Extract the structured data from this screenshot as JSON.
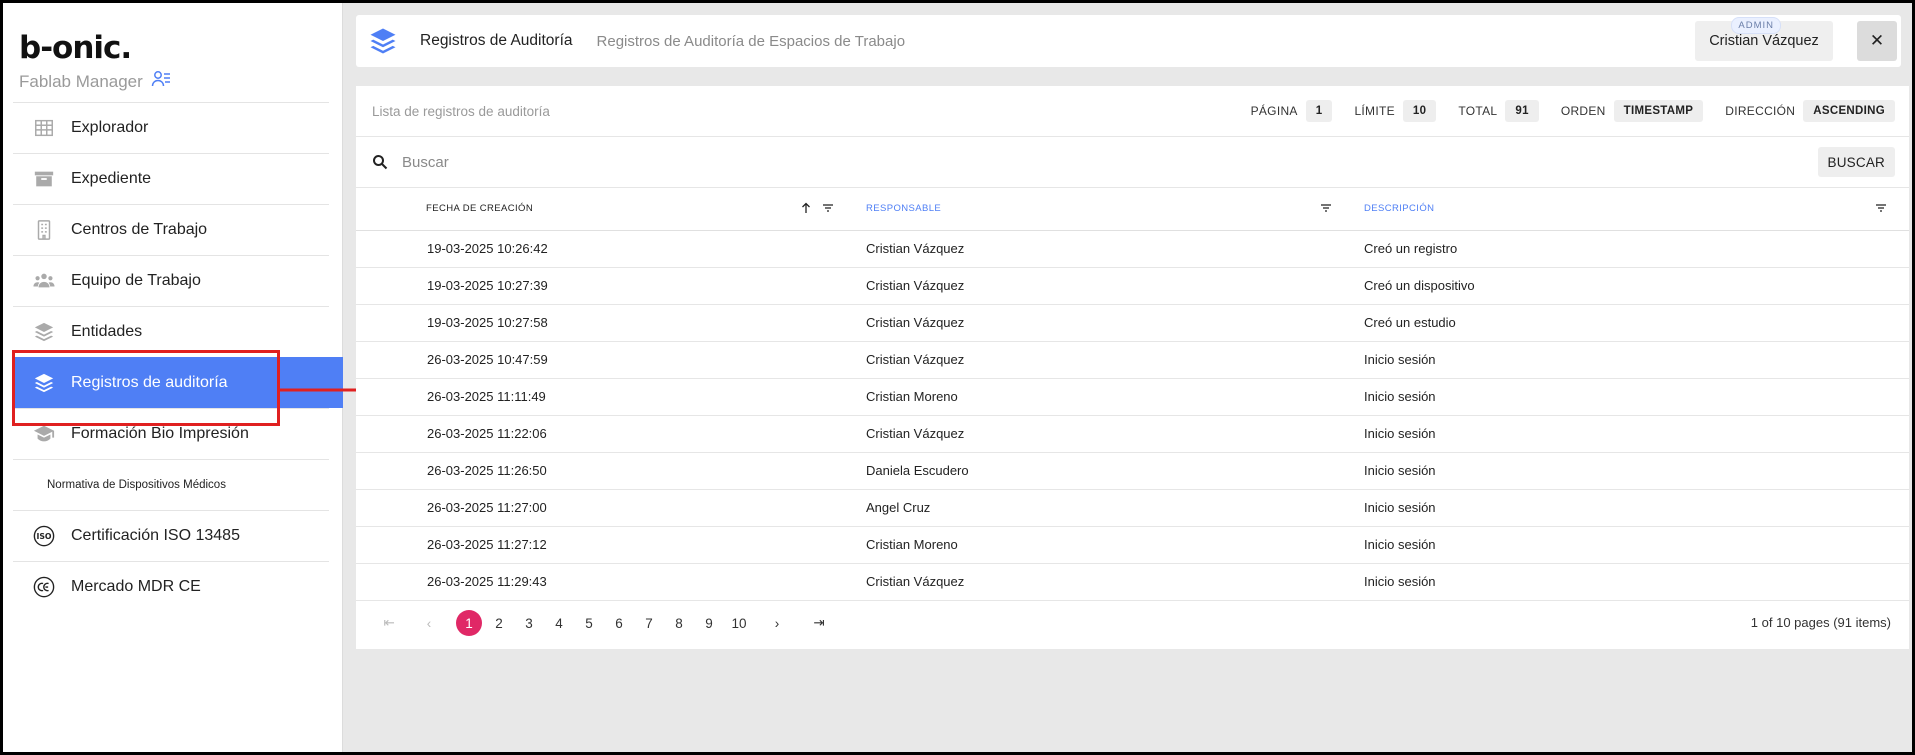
{
  "brand": {
    "logo": "b-onic.",
    "subtitle": "Fablab Manager"
  },
  "sidebar": {
    "items": [
      {
        "label": "Explorador",
        "icon": "grid-icon",
        "active": false
      },
      {
        "label": "Expediente",
        "icon": "archive-box-icon",
        "active": false
      },
      {
        "label": "Centros de Trabajo",
        "icon": "building-icon",
        "active": false
      },
      {
        "label": "Equipo de Trabajo",
        "icon": "team-icon",
        "active": false
      },
      {
        "label": "Entidades",
        "icon": "layers-icon",
        "active": false
      },
      {
        "label": "Registros de auditoría",
        "icon": "layers-icon",
        "active": true
      },
      {
        "label": "Formación Bio Impresión",
        "icon": "graduation-cap-icon",
        "active": false
      },
      {
        "label": "Normativa de Dispositivos Médicos",
        "icon": "",
        "active": false
      },
      {
        "label": "Certificación ISO 13485",
        "icon": "iso-icon",
        "active": false
      },
      {
        "label": "Mercado MDR CE",
        "icon": "ce-mark-icon",
        "active": false
      }
    ]
  },
  "header": {
    "title": "Registros de Auditoría",
    "subtitle": "Registros de Auditoría de Espacios de Trabajo",
    "user": "Cristian Vázquez",
    "role_badge": "ADMIN",
    "close_label": "✕"
  },
  "list": {
    "title": "Lista de registros de auditoría",
    "meta": [
      {
        "label": "PÁGINA",
        "value": "1"
      },
      {
        "label": "LÍMITE",
        "value": "10"
      },
      {
        "label": "TOTAL",
        "value": "91"
      },
      {
        "label": "ORDEN",
        "value": "TIMESTAMP"
      },
      {
        "label": "DIRECCIÓN",
        "value": "ASCENDING"
      }
    ],
    "search_placeholder": "Buscar",
    "search_button": "BUSCAR",
    "columns": [
      "FECHA DE CREACIÓN",
      "RESPONSABLE",
      "DESCRIPCIÓN"
    ],
    "rows": [
      [
        "19-03-2025 10:26:42",
        "Cristian Vázquez",
        "Creó un registro"
      ],
      [
        "19-03-2025 10:27:39",
        "Cristian Vázquez",
        "Creó un dispositivo"
      ],
      [
        "19-03-2025 10:27:58",
        "Cristian Vázquez",
        "Creó un estudio"
      ],
      [
        "26-03-2025 10:47:59",
        "Cristian Vázquez",
        "Inicio sesión"
      ],
      [
        "26-03-2025 11:11:49",
        "Cristian Moreno",
        "Inicio sesión"
      ],
      [
        "26-03-2025 11:22:06",
        "Cristian Vázquez",
        "Inicio sesión"
      ],
      [
        "26-03-2025 11:26:50",
        "Daniela Escudero",
        "Inicio sesión"
      ],
      [
        "26-03-2025 11:27:00",
        "Angel Cruz",
        "Inicio sesión"
      ],
      [
        "26-03-2025 11:27:12",
        "Cristian Moreno",
        "Inicio sesión"
      ],
      [
        "26-03-2025 11:29:43",
        "Cristian Vázquez",
        "Inicio sesión"
      ]
    ]
  },
  "pagination": {
    "first": "⇤",
    "prev": "‹",
    "next": "›",
    "last": "⇥",
    "pages": [
      "1",
      "2",
      "3",
      "4",
      "5",
      "6",
      "7",
      "8",
      "9",
      "10"
    ],
    "current": "1",
    "info": "1 of 10 pages (91 items)"
  },
  "colors": {
    "accent": "#4f7ff5",
    "current_page": "#e02866",
    "annotation": "#e02020"
  }
}
